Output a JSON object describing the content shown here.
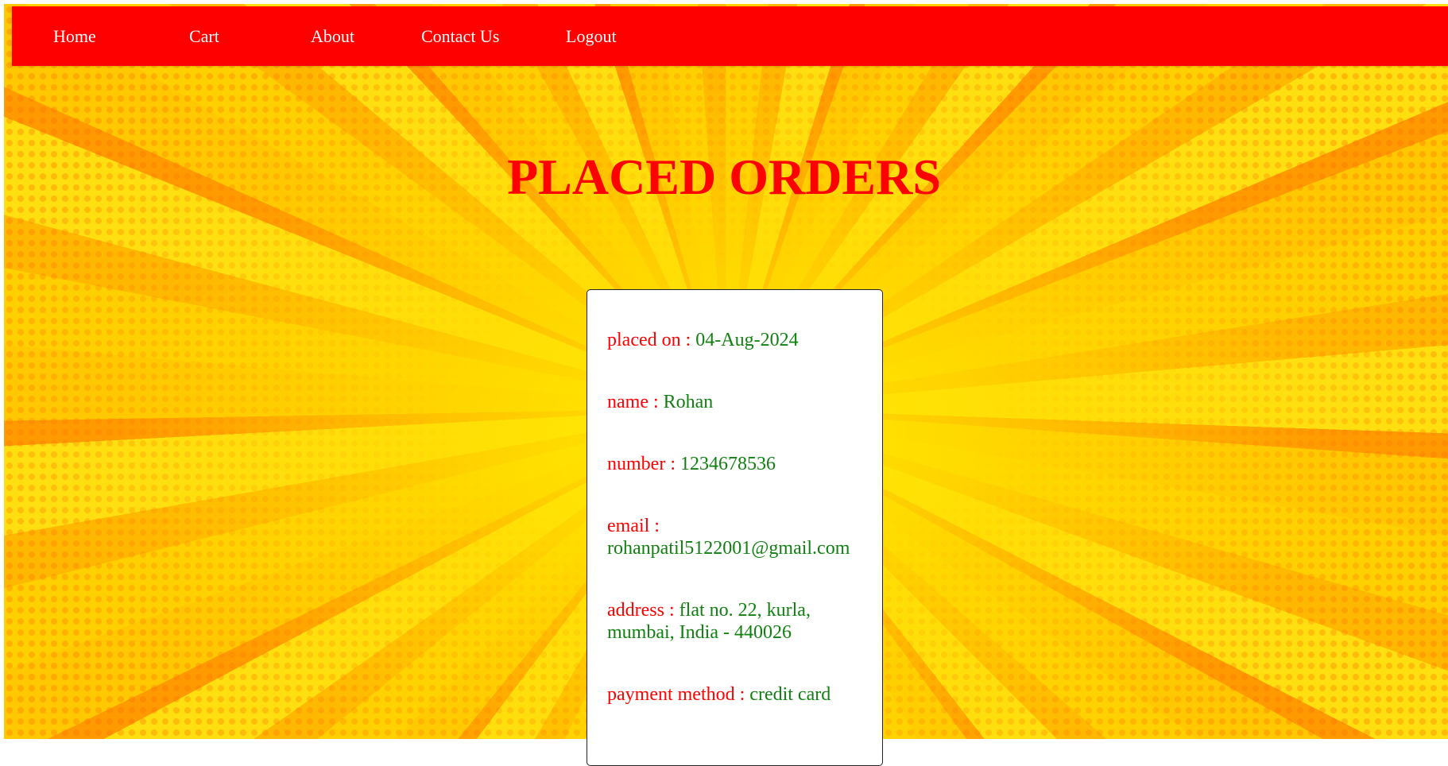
{
  "nav": {
    "home": "Home",
    "cart": "Cart",
    "about": "About",
    "contact": "Contact Us",
    "logout": "Logout"
  },
  "page": {
    "title": "PLACED ORDERS"
  },
  "order": {
    "placed_on": {
      "label": "placed on : ",
      "value": "04-Aug-2024"
    },
    "name": {
      "label": "name : ",
      "value": "Rohan"
    },
    "number": {
      "label": "number : ",
      "value": "1234678536"
    },
    "email": {
      "label": "email : ",
      "value": "rohanpatil5122001@gmail.com"
    },
    "address": {
      "label": "address : ",
      "value": "flat no. 22, kurla, mumbai, India - 440026"
    },
    "payment_method": {
      "label": "payment method : ",
      "value": "credit card"
    }
  },
  "colors": {
    "nav_background": "#ff0000",
    "title": "#ff0000",
    "label": "#ff0000",
    "value": "#108010",
    "background": "#ffc400"
  }
}
